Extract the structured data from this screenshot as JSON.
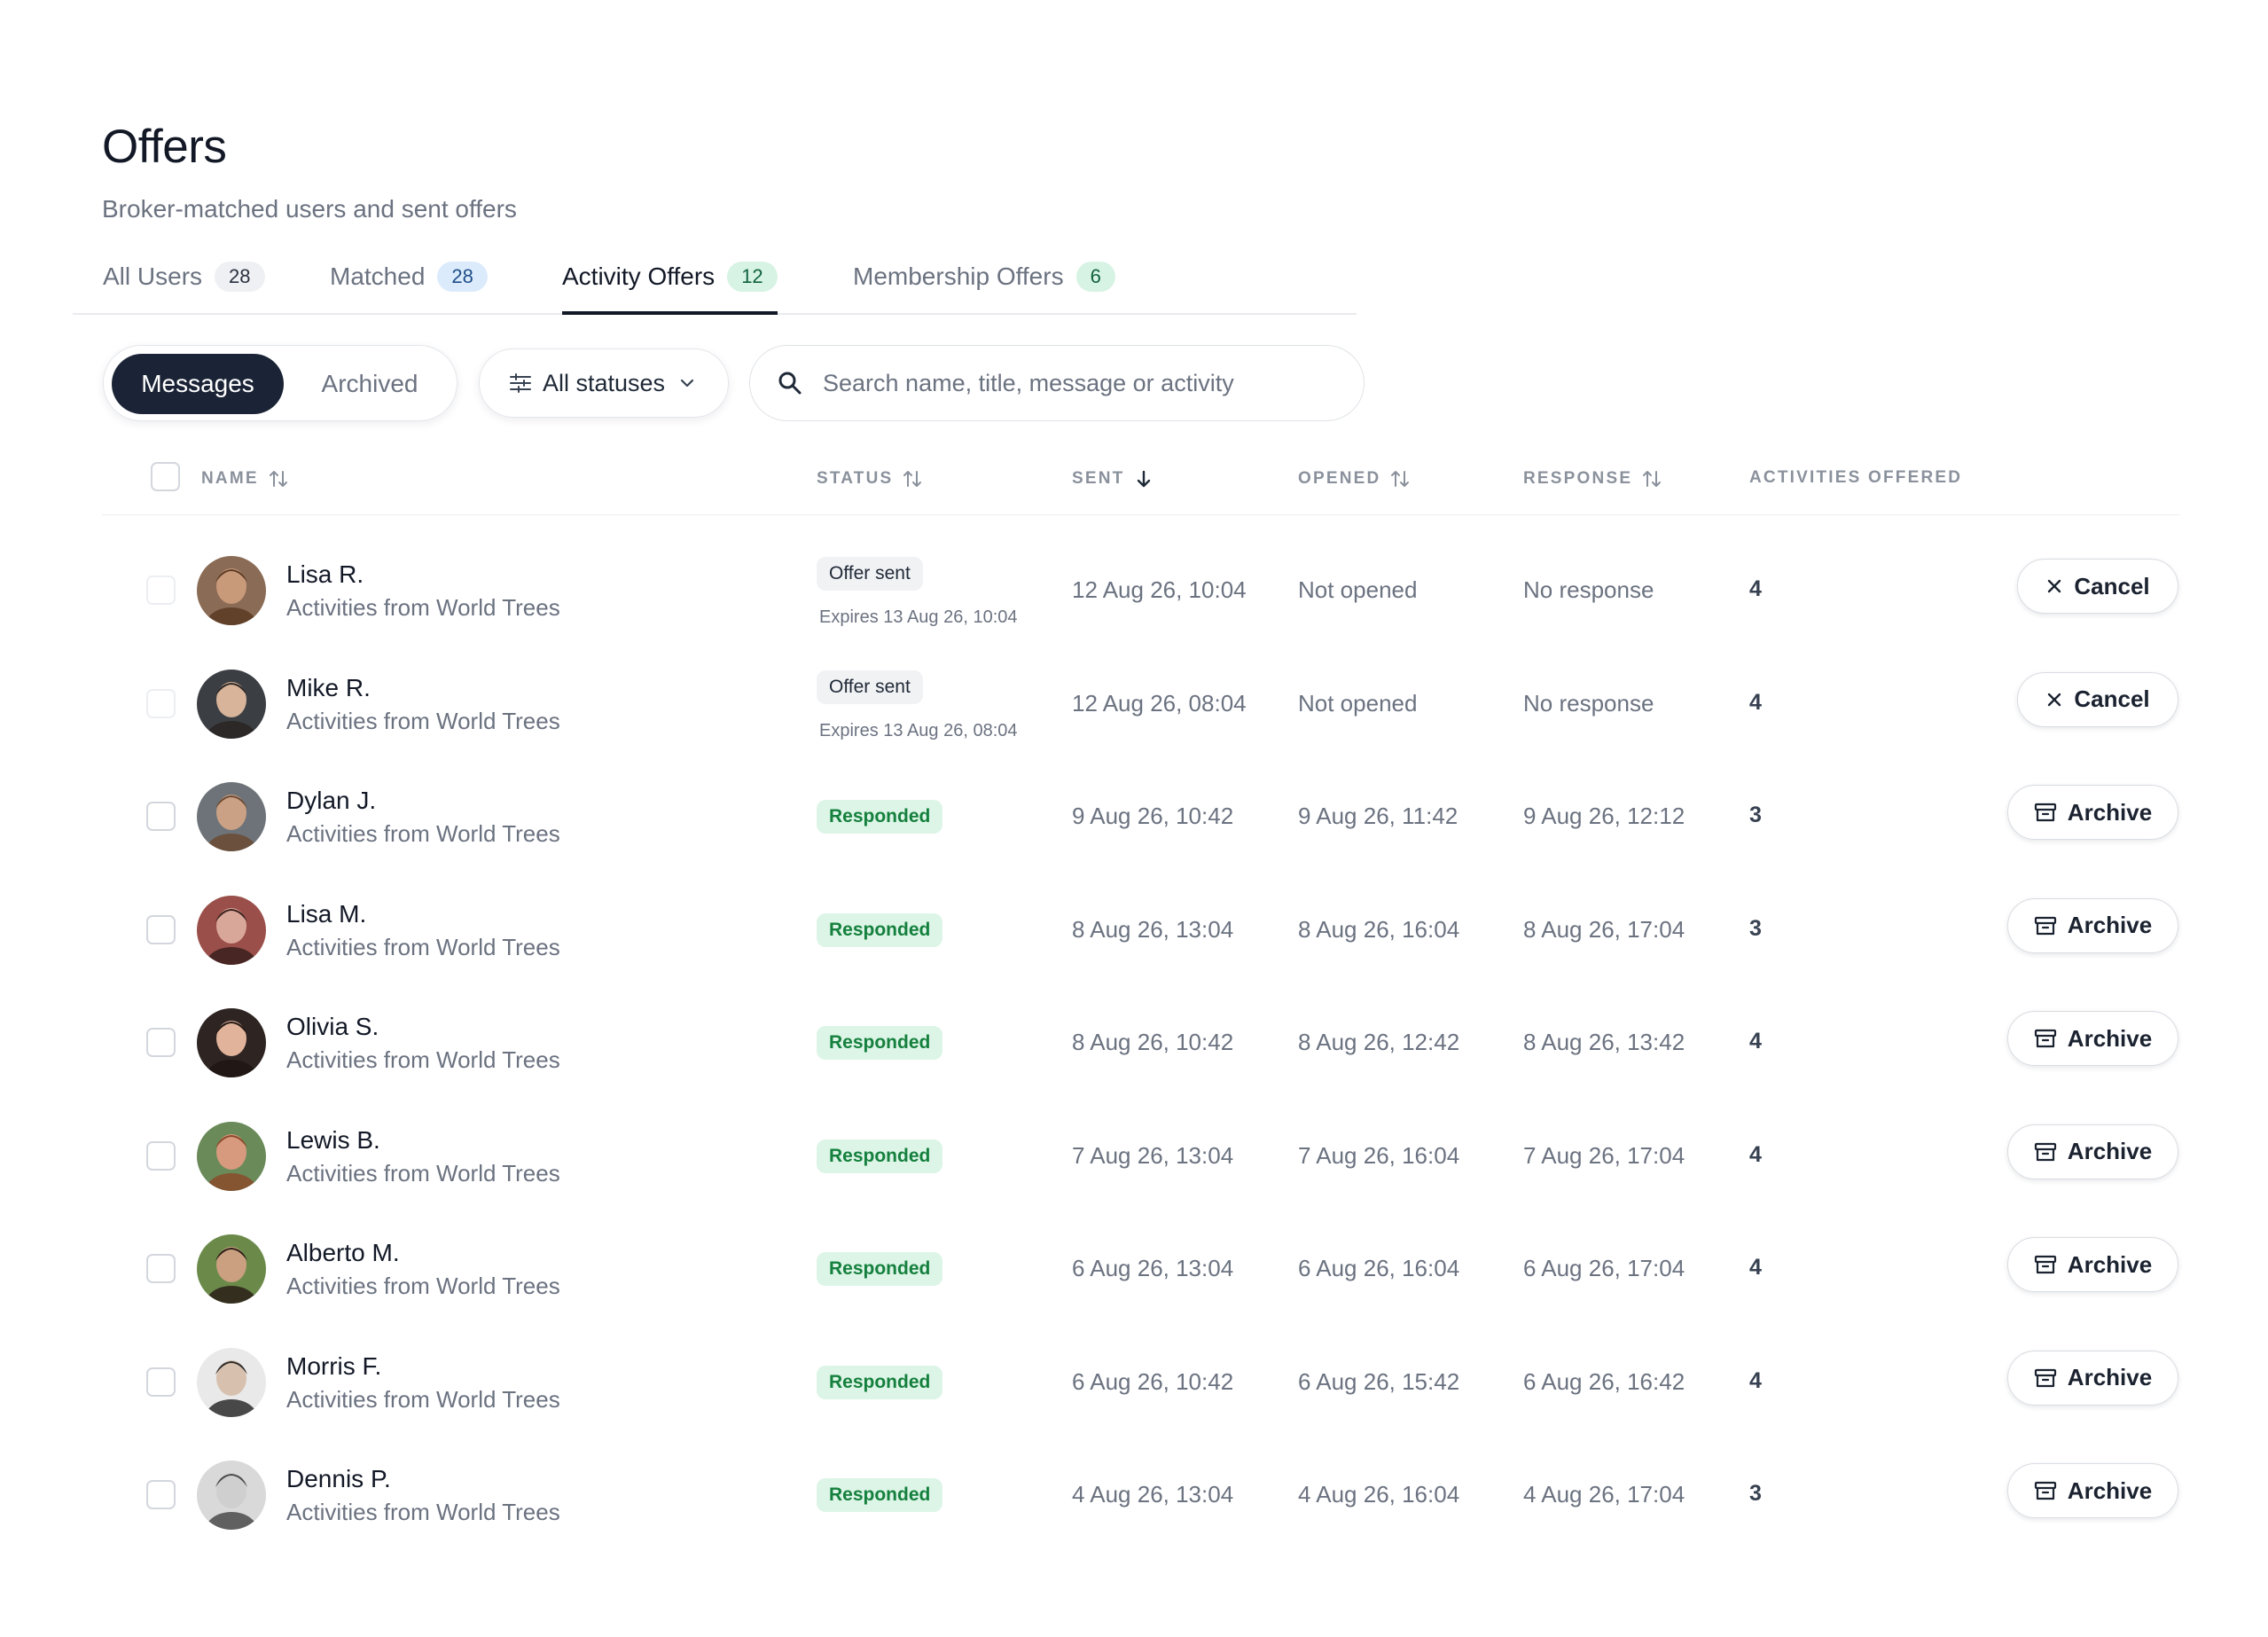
{
  "header": {
    "title": "Offers",
    "subtitle": "Broker-matched users and sent offers"
  },
  "tabs": [
    {
      "label": "All Users",
      "count": "28"
    },
    {
      "label": "Matched",
      "count": "28"
    },
    {
      "label": "Activity Offers",
      "count": "12"
    },
    {
      "label": "Membership Offers",
      "count": "6"
    }
  ],
  "toolbar": {
    "messages_label": "Messages",
    "archived_label": "Archived",
    "filter_label": "All statuses",
    "search_placeholder": "Search name, title, message or activity"
  },
  "columns": {
    "name": "NAME",
    "status": "STATUS",
    "sent": "SENT",
    "opened": "OPENED",
    "response": "RESPONSE",
    "activities": "ACTIVITIES OFFERED"
  },
  "rows": [
    {
      "name": "Lisa R.",
      "sub": "Activities from World Trees",
      "status": "Offer sent",
      "expires": "Expires 13 Aug 26, 10:04",
      "sent": "12 Aug 26, 10:04",
      "opened": "Not opened",
      "response": "No response",
      "activities": "4",
      "action": "Cancel"
    },
    {
      "name": "Mike R.",
      "sub": "Activities from World Trees",
      "status": "Offer sent",
      "expires": "Expires 13 Aug 26, 08:04",
      "sent": "12 Aug 26, 08:04",
      "opened": "Not opened",
      "response": "No response",
      "activities": "4",
      "action": "Cancel"
    },
    {
      "name": "Dylan J.",
      "sub": "Activities from World Trees",
      "status": "Responded",
      "sent": "9 Aug 26, 10:42",
      "opened": "9 Aug 26, 11:42",
      "response": "9 Aug 26, 12:12",
      "activities": "3",
      "action": "Archive"
    },
    {
      "name": "Lisa M.",
      "sub": "Activities from World Trees",
      "status": "Responded",
      "sent": "8 Aug 26, 13:04",
      "opened": "8 Aug 26, 16:04",
      "response": "8 Aug 26, 17:04",
      "activities": "3",
      "action": "Archive"
    },
    {
      "name": "Olivia S.",
      "sub": "Activities from World Trees",
      "status": "Responded",
      "sent": "8 Aug 26, 10:42",
      "opened": "8 Aug 26, 12:42",
      "response": "8 Aug 26, 13:42",
      "activities": "4",
      "action": "Archive"
    },
    {
      "name": "Lewis B.",
      "sub": "Activities from World Trees",
      "status": "Responded",
      "sent": "7 Aug 26, 13:04",
      "opened": "7 Aug 26, 16:04",
      "response": "7 Aug 26, 17:04",
      "activities": "4",
      "action": "Archive"
    },
    {
      "name": "Alberto M.",
      "sub": "Activities from World Trees",
      "status": "Responded",
      "sent": "6 Aug 26, 13:04",
      "opened": "6 Aug 26, 16:04",
      "response": "6 Aug 26, 17:04",
      "activities": "4",
      "action": "Archive"
    },
    {
      "name": "Morris F.",
      "sub": "Activities from World Trees",
      "status": "Responded",
      "sent": "6 Aug 26, 10:42",
      "opened": "6 Aug 26, 15:42",
      "response": "6 Aug 26, 16:42",
      "activities": "4",
      "action": "Archive"
    },
    {
      "name": "Dennis P.",
      "sub": "Activities from World Trees",
      "status": "Responded",
      "sent": "4 Aug 26, 13:04",
      "opened": "4 Aug 26, 16:04",
      "response": "4 Aug 26, 17:04",
      "activities": "3",
      "action": "Archive"
    }
  ],
  "avatar_palette": [
    {
      "skin": "#c99a7a",
      "hair": "#5a3a24",
      "bg": "#8a6b55"
    },
    {
      "skin": "#d8b49a",
      "hair": "#2a2523",
      "bg": "#3b3f44"
    },
    {
      "skin": "#caa184",
      "hair": "#6b4a33",
      "bg": "#6d7378"
    },
    {
      "skin": "#d9a79a",
      "hair": "#3a1f1c",
      "bg": "#9a4f4a"
    },
    {
      "skin": "#e0b39a",
      "hair": "#1e1512",
      "bg": "#2e2422"
    },
    {
      "skin": "#d79a7e",
      "hair": "#8a4a2a",
      "bg": "#6a8a5a"
    },
    {
      "skin": "#caa080",
      "hair": "#2a1d16",
      "bg": "#6b8a4a"
    },
    {
      "skin": "#d7c0ad",
      "hair": "#2b2b2b",
      "bg": "#e9e9e9"
    },
    {
      "skin": "#cfcfcf",
      "hair": "#4a4a4a",
      "bg": "#d9d9d9"
    }
  ],
  "colors": {
    "accent_dark": "#1b2436",
    "responded_bg": "#dcf5e7",
    "responded_text": "#15803d"
  }
}
